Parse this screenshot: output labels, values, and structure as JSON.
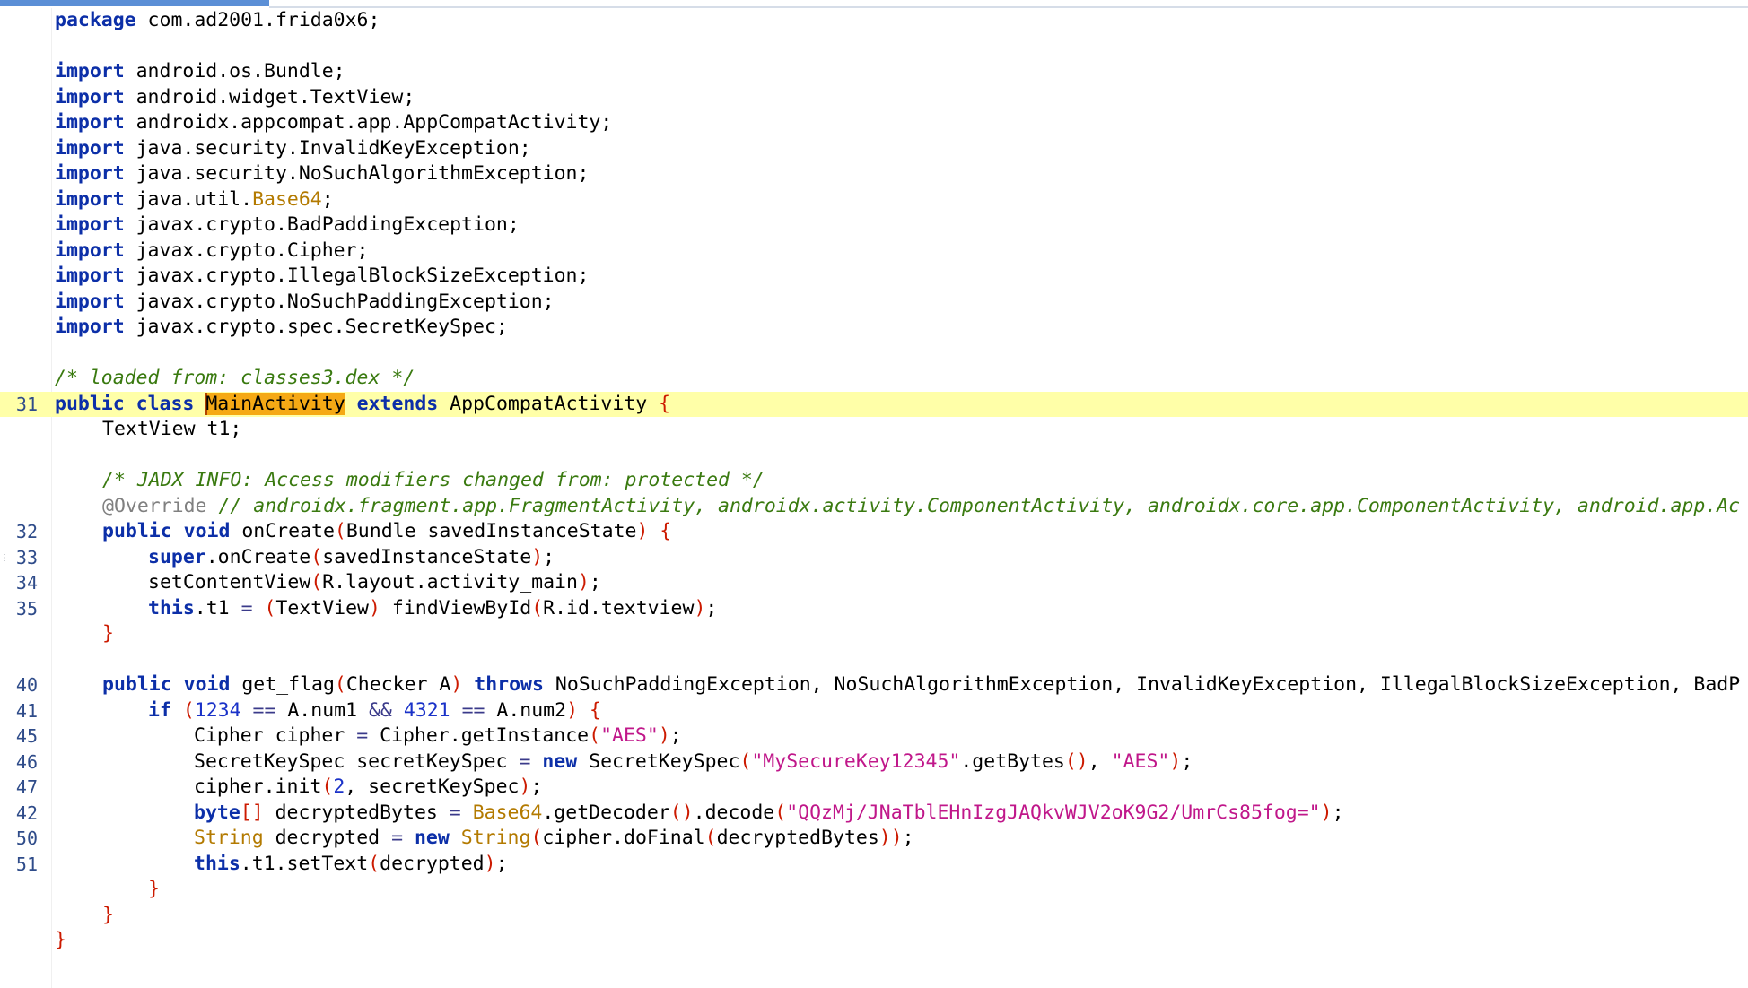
{
  "editor": {
    "current_line_number": "31",
    "lines": [
      {
        "n": "",
        "t": "package com.ad2001.frida0x6;"
      },
      {
        "n": "",
        "t": ""
      },
      {
        "n": "",
        "t": "import android.os.Bundle;"
      },
      {
        "n": "",
        "t": "import android.widget.TextView;"
      },
      {
        "n": "",
        "t": "import androidx.appcompat.app.AppCompatActivity;"
      },
      {
        "n": "",
        "t": "import java.security.InvalidKeyException;"
      },
      {
        "n": "",
        "t": "import java.security.NoSuchAlgorithmException;"
      },
      {
        "n": "",
        "t": "import java.util.Base64;"
      },
      {
        "n": "",
        "t": "import javax.crypto.BadPaddingException;"
      },
      {
        "n": "",
        "t": "import javax.crypto.Cipher;"
      },
      {
        "n": "",
        "t": "import javax.crypto.IllegalBlockSizeException;"
      },
      {
        "n": "",
        "t": "import javax.crypto.NoSuchPaddingException;"
      },
      {
        "n": "",
        "t": "import javax.crypto.spec.SecretKeySpec;"
      },
      {
        "n": "",
        "t": ""
      },
      {
        "n": "",
        "t": "/* loaded from: classes3.dex */"
      },
      {
        "n": "31",
        "t": "public class MainActivity extends AppCompatActivity {"
      },
      {
        "n": "",
        "t": "    TextView t1;"
      },
      {
        "n": "",
        "t": ""
      },
      {
        "n": "",
        "t": "    /* JADX INFO: Access modifiers changed from: protected */"
      },
      {
        "n": "",
        "t": "    @Override // androidx.fragment.app.FragmentActivity, androidx.activity.ComponentActivity, androidx.core.app.ComponentActivity, android.app.Ac"
      },
      {
        "n": "32",
        "t": "    public void onCreate(Bundle savedInstanceState) {"
      },
      {
        "n": "33",
        "t": "        super.onCreate(savedInstanceState);"
      },
      {
        "n": "34",
        "t": "        setContentView(R.layout.activity_main);"
      },
      {
        "n": "35",
        "t": "        this.t1 = (TextView) findViewById(R.id.textview);"
      },
      {
        "n": "",
        "t": "    }"
      },
      {
        "n": "",
        "t": ""
      },
      {
        "n": "40",
        "t": "    public void get_flag(Checker A) throws NoSuchPaddingException, NoSuchAlgorithmException, InvalidKeyException, IllegalBlockSizeException, BadP"
      },
      {
        "n": "41",
        "t": "        if (1234 == A.num1 && 4321 == A.num2) {"
      },
      {
        "n": "45",
        "t": "            Cipher cipher = Cipher.getInstance(\"AES\");"
      },
      {
        "n": "46",
        "t": "            SecretKeySpec secretKeySpec = new SecretKeySpec(\"MySecureKey12345\".getBytes(), \"AES\");"
      },
      {
        "n": "47",
        "t": "            cipher.init(2, secretKeySpec);"
      },
      {
        "n": "42",
        "t": "            byte[] decryptedBytes = Base64.getDecoder().decode(\"QQzMj/JNaTblEHnIzgJAQkvWJV2oK9G2/UmrCs85fog=\");"
      },
      {
        "n": "50",
        "t": "            String decrypted = new String(cipher.doFinal(decryptedBytes));"
      },
      {
        "n": "51",
        "t": "            this.t1.setText(decrypted);"
      },
      {
        "n": "",
        "t": "        }"
      },
      {
        "n": "",
        "t": "    }"
      },
      {
        "n": "",
        "t": "}"
      }
    ]
  },
  "colors": {
    "keyword": "#0c2fa8",
    "comment": "#3a7a10",
    "string": "#c0178a",
    "type_highlight": "#b37a00",
    "brace": "#cc1a00",
    "current_line_bg": "#ffffa8",
    "selection_bg": "#f5a915"
  }
}
